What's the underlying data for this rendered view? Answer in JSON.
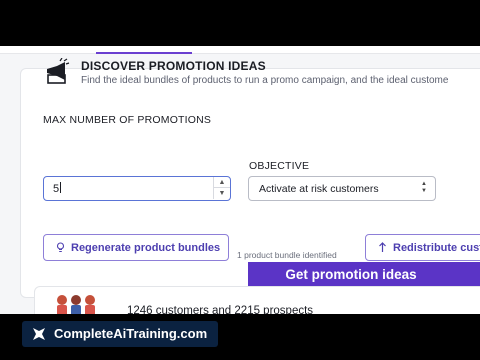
{
  "section": {
    "title": "DISCOVER PROMOTION IDEAS",
    "subtitle": "Find the ideal bundles of products to run a promo campaign, and the ideal custome",
    "icon": "megaphone-icon"
  },
  "max_promotions": {
    "label": "MAX NUMBER OF PROMOTIONS",
    "value": "5"
  },
  "objective": {
    "label": "OBJECTIVE",
    "value": "Activate at risk customers"
  },
  "buttons": {
    "regenerate": "Regenerate product bundles",
    "redistribute": "Redistribute cust"
  },
  "bundle_count": "1 product bundle identified",
  "banner": "Get promotion ideas",
  "customers": {
    "text": "1246 customers and 2215 prospects",
    "icon": "people-icon"
  },
  "brand": {
    "text": "CompleteAiTraining.com",
    "icon": "brand-logo-icon"
  },
  "colors": {
    "accent": "#5b34c6",
    "button_text": "#4d3fb0",
    "focus_border": "#5a74d6",
    "brand_box": "#0b2240"
  }
}
